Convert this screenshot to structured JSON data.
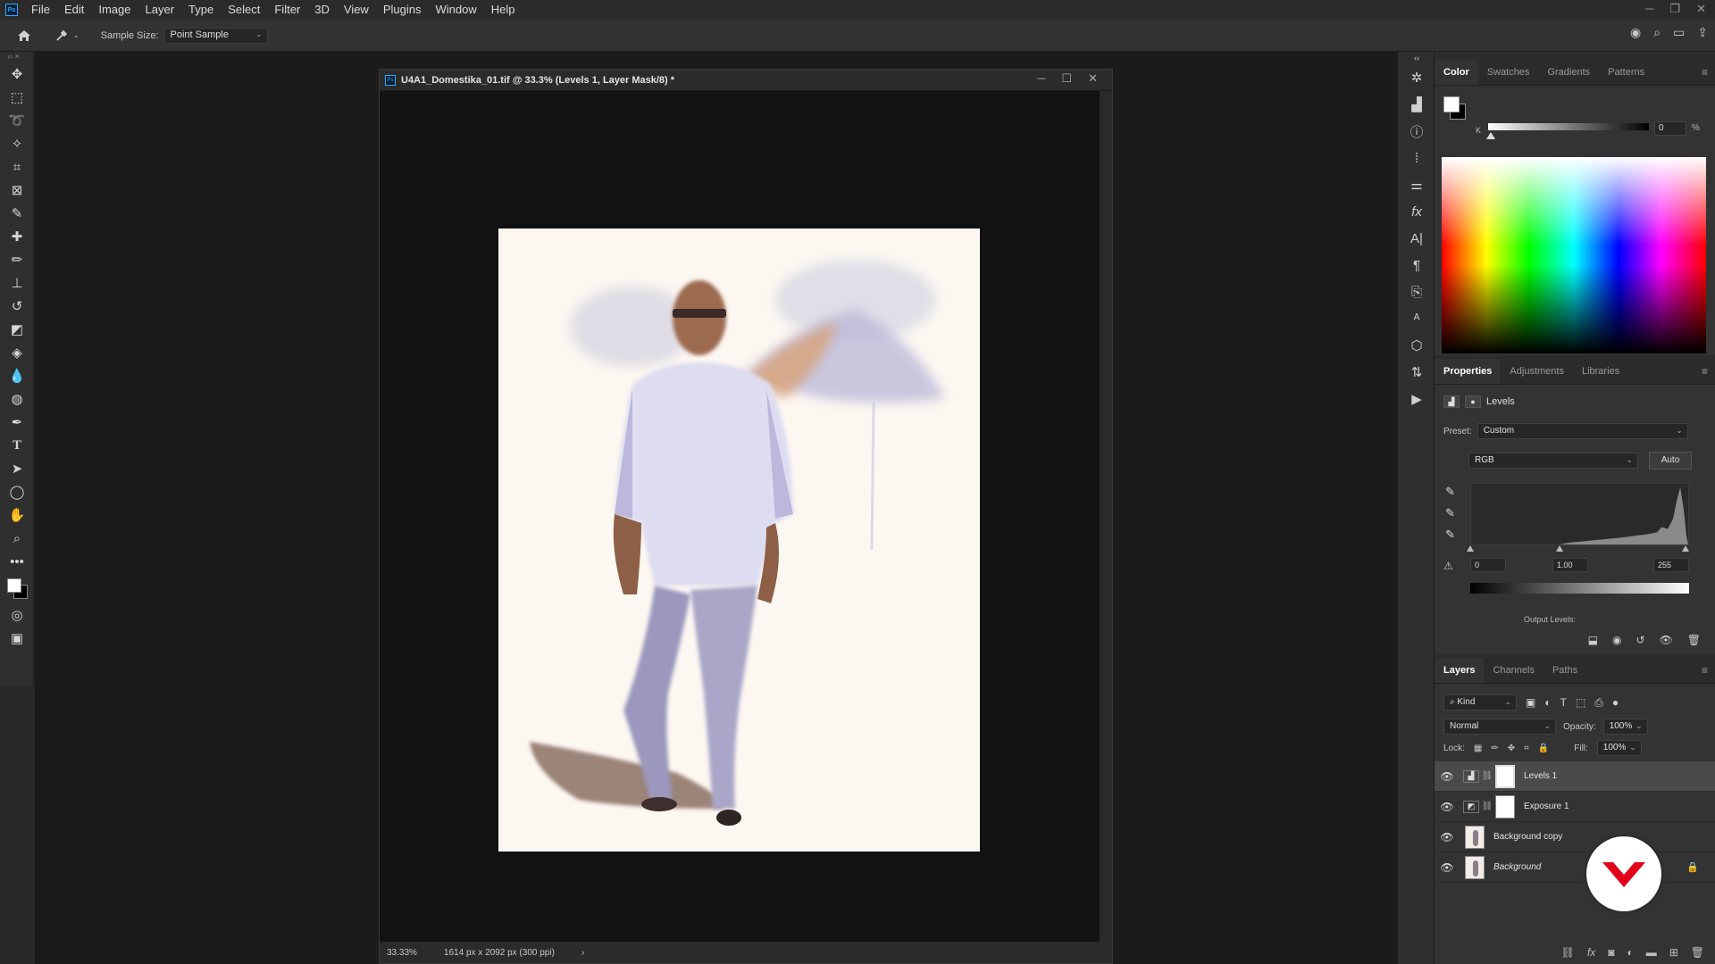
{
  "menubar": {
    "logo": "Ps",
    "items": [
      "File",
      "Edit",
      "Image",
      "Layer",
      "Type",
      "Select",
      "Filter",
      "3D",
      "View",
      "Plugins",
      "Window",
      "Help"
    ]
  },
  "options": {
    "sample_size_label": "Sample Size:",
    "sample_size_value": "Point Sample"
  },
  "document": {
    "title": "U4A1_Domestika_01.tif @ 33.3% (Levels 1, Layer Mask/8) *",
    "zoom": "33.33%",
    "info": "1614 px x 2092 px (300 ppi)"
  },
  "color_panel": {
    "tabs": [
      "Color",
      "Swatches",
      "Gradients",
      "Patterns"
    ],
    "channel_label": "K",
    "k_value": "0",
    "unit": "%"
  },
  "properties_panel": {
    "tabs": [
      "Properties",
      "Adjustments",
      "Libraries"
    ],
    "adjustment_name": "Levels",
    "preset_label": "Preset:",
    "preset_value": "Custom",
    "channel_value": "RGB",
    "auto_label": "Auto",
    "input_black": "0",
    "input_gamma": "1.00",
    "input_white": "255",
    "output_label": "Output Levels:"
  },
  "layers_panel": {
    "tabs": [
      "Layers",
      "Channels",
      "Paths"
    ],
    "filter_kind": "Kind",
    "blend_mode": "Normal",
    "opacity_label": "Opacity:",
    "opacity_value": "100%",
    "lock_label": "Lock:",
    "fill_label": "Fill:",
    "fill_value": "100%",
    "layers": [
      {
        "name": "Levels 1",
        "selected": true
      },
      {
        "name": "Exposure 1",
        "selected": false
      },
      {
        "name": "Background copy",
        "selected": false
      },
      {
        "name": "Background",
        "selected": false
      }
    ]
  },
  "colors": {
    "accent": "#31a8ff",
    "brand": "#e2001a"
  }
}
